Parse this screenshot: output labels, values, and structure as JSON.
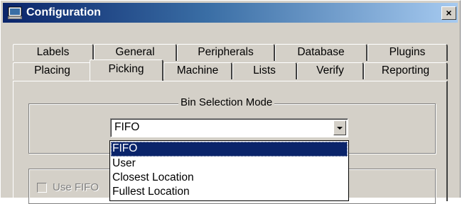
{
  "window": {
    "title": "Configuration",
    "close_label": "×"
  },
  "tabs": {
    "back_row": [
      "Labels",
      "General",
      "Peripherals",
      "Database",
      "Plugins"
    ],
    "front_row": [
      "Placing",
      "Picking",
      "Machine",
      "Lists",
      "Verify",
      "Reporting"
    ],
    "active": "Picking"
  },
  "bin_selection": {
    "group_label": "Bin Selection Mode",
    "selected_value": "FIFO",
    "options": [
      "FIFO",
      "User",
      "Closest Location",
      "Fullest Location"
    ],
    "highlighted_option": "FIFO"
  },
  "lower_group": {
    "checkbox_label": "Use FIFO",
    "checkbox_checked": false,
    "checkbox_enabled": false
  }
}
